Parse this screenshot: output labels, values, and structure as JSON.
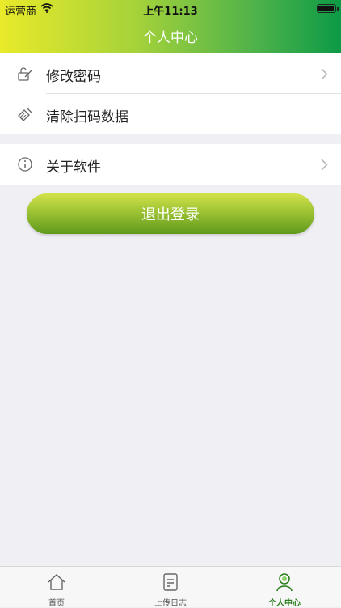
{
  "status": {
    "carrier": "运营商",
    "time": "上午11:13",
    "battery_level": 0.95
  },
  "header": {
    "title": "个人中心"
  },
  "menu": {
    "group1": [
      {
        "label": "修改密码",
        "icon": "unlock-icon",
        "has_chevron": true
      },
      {
        "label": "清除扫码数据",
        "icon": "broom-icon",
        "has_chevron": false
      }
    ],
    "group2": [
      {
        "label": "关于软件",
        "icon": "info-icon",
        "has_chevron": true
      }
    ]
  },
  "logout_label": "退出登录",
  "tabbar": {
    "tabs": [
      {
        "label": "首页",
        "icon": "home-icon"
      },
      {
        "label": "上传日志",
        "icon": "document-icon"
      },
      {
        "label": "个人中心",
        "icon": "person-icon"
      }
    ],
    "active_index": 2,
    "active_color": "#2c7f1e"
  }
}
